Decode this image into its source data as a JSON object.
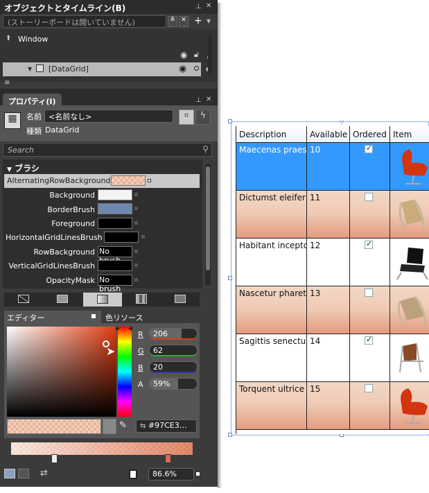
{
  "objects": {
    "title": "オブジェクトとタイムライン(B)",
    "storyboard": "(ストーリーボードは開いていません)",
    "root": "Window",
    "selected": "[DataGrid]"
  },
  "properties": {
    "title": "プロパティ(I)",
    "name_label": "名前",
    "name_value": "<名前なし>",
    "type_label": "種類",
    "type_value": "DataGrid",
    "search_placeholder": "Search",
    "brush_section": "ブラシ",
    "brushes": [
      {
        "label": "AlternatingRowBackground",
        "value": ""
      },
      {
        "label": "Background",
        "value": ""
      },
      {
        "label": "BorderBrush",
        "value": ""
      },
      {
        "label": "Foreground",
        "value": ""
      },
      {
        "label": "HorizontalGridLinesBrush",
        "value": ""
      },
      {
        "label": "RowBackground",
        "value": "No brush"
      },
      {
        "label": "VerticalGridLinesBrush",
        "value": ""
      },
      {
        "label": "OpacityMask",
        "value": "No brush"
      }
    ],
    "editor_tab": "エディター",
    "resources_tab": "色リソース",
    "channels": [
      {
        "label": "R",
        "value": "206",
        "fill": 0.81
      },
      {
        "label": "G",
        "value": "62",
        "fill": 0.24
      },
      {
        "label": "B",
        "value": "20",
        "fill": 0.08
      },
      {
        "label": "A",
        "value": "59%",
        "fill": 0.59
      }
    ],
    "hex": "#97CE3…",
    "gradient_offset": "86.6%"
  },
  "grid": {
    "columns": [
      "Description",
      "Available",
      "Ordered",
      "Item"
    ],
    "rows": [
      {
        "description": "Maecenas praes",
        "available": "10",
        "ordered": true,
        "item": "swan-chair-red"
      },
      {
        "description": "Dictumst eleifer",
        "available": "11",
        "ordered": false,
        "item": "lounge-chair-tan"
      },
      {
        "description": "Habitant incepto",
        "available": "12",
        "ordered": true,
        "item": "barcelona-chair-black"
      },
      {
        "description": "Nascetur pharet",
        "available": "13",
        "ordered": false,
        "item": "lounge-chair-tan"
      },
      {
        "description": "Sagittis senectu",
        "available": "14",
        "ordered": true,
        "item": "sling-chair-brown"
      },
      {
        "description": "Torquent ultrice",
        "available": "15",
        "ordered": false,
        "item": "swan-chair-red"
      }
    ]
  },
  "colors": {
    "selected_row": "#3399ff",
    "alt_row": "#f0cbb6",
    "accent": "#ce3e14"
  }
}
